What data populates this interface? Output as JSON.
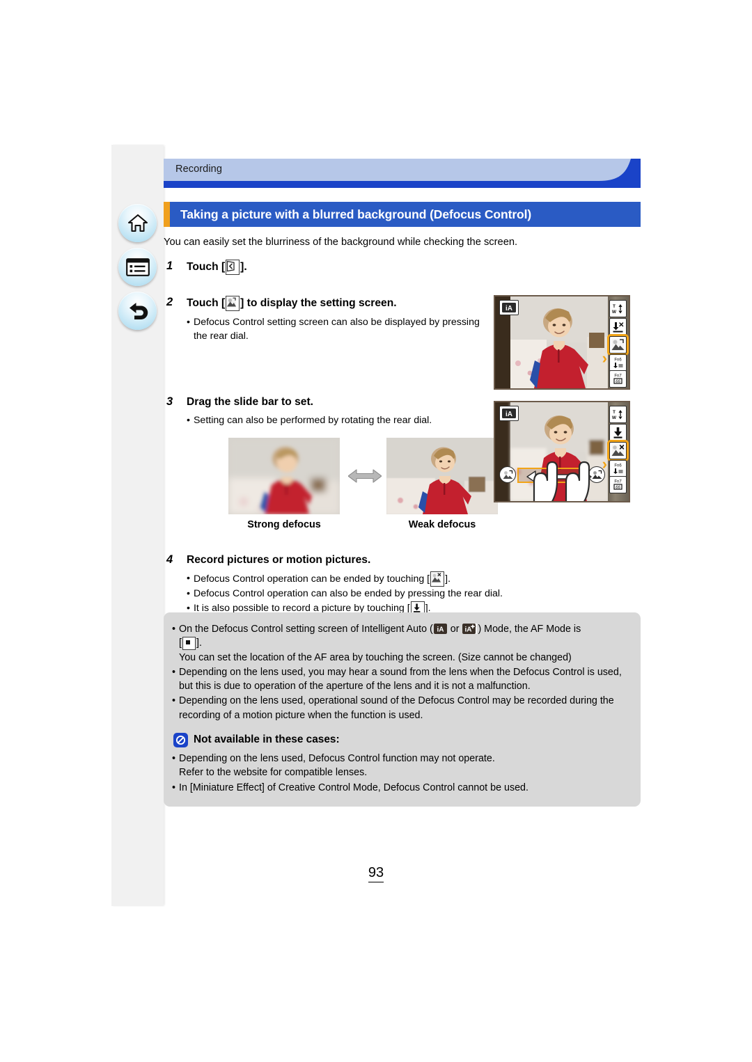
{
  "nav": {
    "home_label": "Home",
    "toc_label": "Contents",
    "back_label": "Return"
  },
  "header": {
    "breadcrumb": "Recording",
    "title": "Taking a picture with a blurred background (Defocus Control)",
    "accent_color": "#f0a01e",
    "title_bar_color": "#2a5bc4",
    "breadcrumb_band_color": "#b6c7e8",
    "breadcrumb_rule_color": "#1a43c8"
  },
  "intro": "You can easily set the blurriness of the background while checking the screen.",
  "steps": [
    {
      "num": "1",
      "head_before": "Touch [",
      "head_icon": "back-arrow-touch-icon",
      "head_after": "]."
    },
    {
      "num": "2",
      "head_before": "Touch [",
      "head_icon": "defocus-control-icon",
      "head_after": "] to display the setting screen.",
      "bullets": [
        "Defocus Control setting screen can also be displayed by pressing the rear dial."
      ]
    },
    {
      "num": "3",
      "head": "Drag the slide bar to set.",
      "bullets": [
        "Setting can also be performed by rotating the rear dial."
      ]
    },
    {
      "num": "4",
      "head": "Record pictures or motion pictures.",
      "bullets_rich": [
        {
          "before": "Defocus Control operation can be ended by touching [",
          "icon": "defocus-control-exit-icon",
          "after": "]."
        },
        {
          "before": "Defocus Control operation can also be ended by pressing the rear dial.",
          "icon": null,
          "after": ""
        },
        {
          "before": "It is also possible to record a picture by touching [",
          "icon": "shutter-download-icon",
          "after": "]."
        }
      ]
    }
  ],
  "compare": {
    "left_caption": "Strong defocus",
    "right_caption": "Weak defocus",
    "arrow_icon": "double-arrow-icon"
  },
  "camera_screens": [
    {
      "name": "setting-screen-entry",
      "mode_badge": "iA",
      "rail_icons": [
        "zoom-tw-icon",
        "touch-shutter-icon",
        "defocus-control-icon",
        "fn6-icon",
        "fn7-icon"
      ],
      "highlighted_index": 2,
      "fn_labels": [
        "Fn6",
        "Fn7"
      ]
    },
    {
      "name": "slide-bar-screen",
      "mode_badge": "iA",
      "rail_icons": [
        "zoom-tw-icon",
        "shutter-download-icon",
        "defocus-control-exit-icon",
        "fn6-icon",
        "fn7-icon"
      ],
      "highlighted_index": 2,
      "fn_labels": [
        "Fn6",
        "Fn7"
      ],
      "slider": {
        "left_end_icon": "strong-defocus-icon",
        "right_end_icon": "weak-defocus-icon",
        "drag_gesture": "finger-drag-icon"
      }
    }
  ],
  "notes": {
    "items": [
      {
        "before": "On the Defocus Control setting screen of Intelligent Auto (",
        "icon1": "ia-mode-icon",
        "mid": " or ",
        "icon2": "ia-plus-mode-icon",
        "after": ") Mode, the AF Mode is",
        "line2_before": "[",
        "line2_icon": "af-1-area-icon",
        "line2_after": "].",
        "line3": "You can set the location of the AF area by touching the screen. (Size cannot be changed)"
      },
      {
        "text": "Depending on the lens used, you may hear a sound from the lens when the Defocus Control is used, but this is due to operation of the aperture of the lens and it is not a malfunction."
      },
      {
        "text": "Depending on the lens used, operational sound of the Defocus Control may be recorded during the recording of a motion picture when the function is used."
      }
    ],
    "not_available": {
      "icon": "prohibition-icon",
      "heading": "Not available in these cases:",
      "items": [
        {
          "line1": "Depending on the lens used, Defocus Control function may not operate.",
          "line2": "Refer to the website for compatible lenses."
        },
        {
          "line1": "In [Miniature Effect] of Creative Control Mode, Defocus Control cannot be used.",
          "line2": ""
        }
      ]
    }
  },
  "footer": {
    "page_number": "93"
  }
}
